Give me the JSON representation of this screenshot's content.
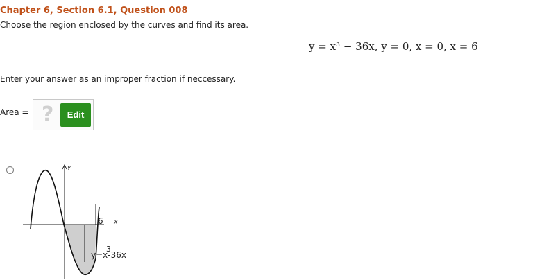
{
  "question": {
    "header": "Chapter 6, Section 6.1, Question 008",
    "instruction": "Choose the region enclosed by the curves and find its area.",
    "equation": "y = x³ − 36x, y = 0, x = 0, x = 6",
    "note": "Enter your answer as an improper fraction if neccessary."
  },
  "answer": {
    "label": "Area =",
    "placeholder_glyph": "?",
    "edit_label": "Edit",
    "edit_color": "#2a8f1e"
  },
  "option": {
    "graph": {
      "y_axis_label": "y",
      "x_axis_label": "x",
      "tick_label": "6",
      "curve_label_prefix": "y=",
      "curve_label_var": "x",
      "curve_label_exp": "3",
      "curve_label_suffix": "-36x",
      "shade_color": "#cfcfcf"
    }
  }
}
